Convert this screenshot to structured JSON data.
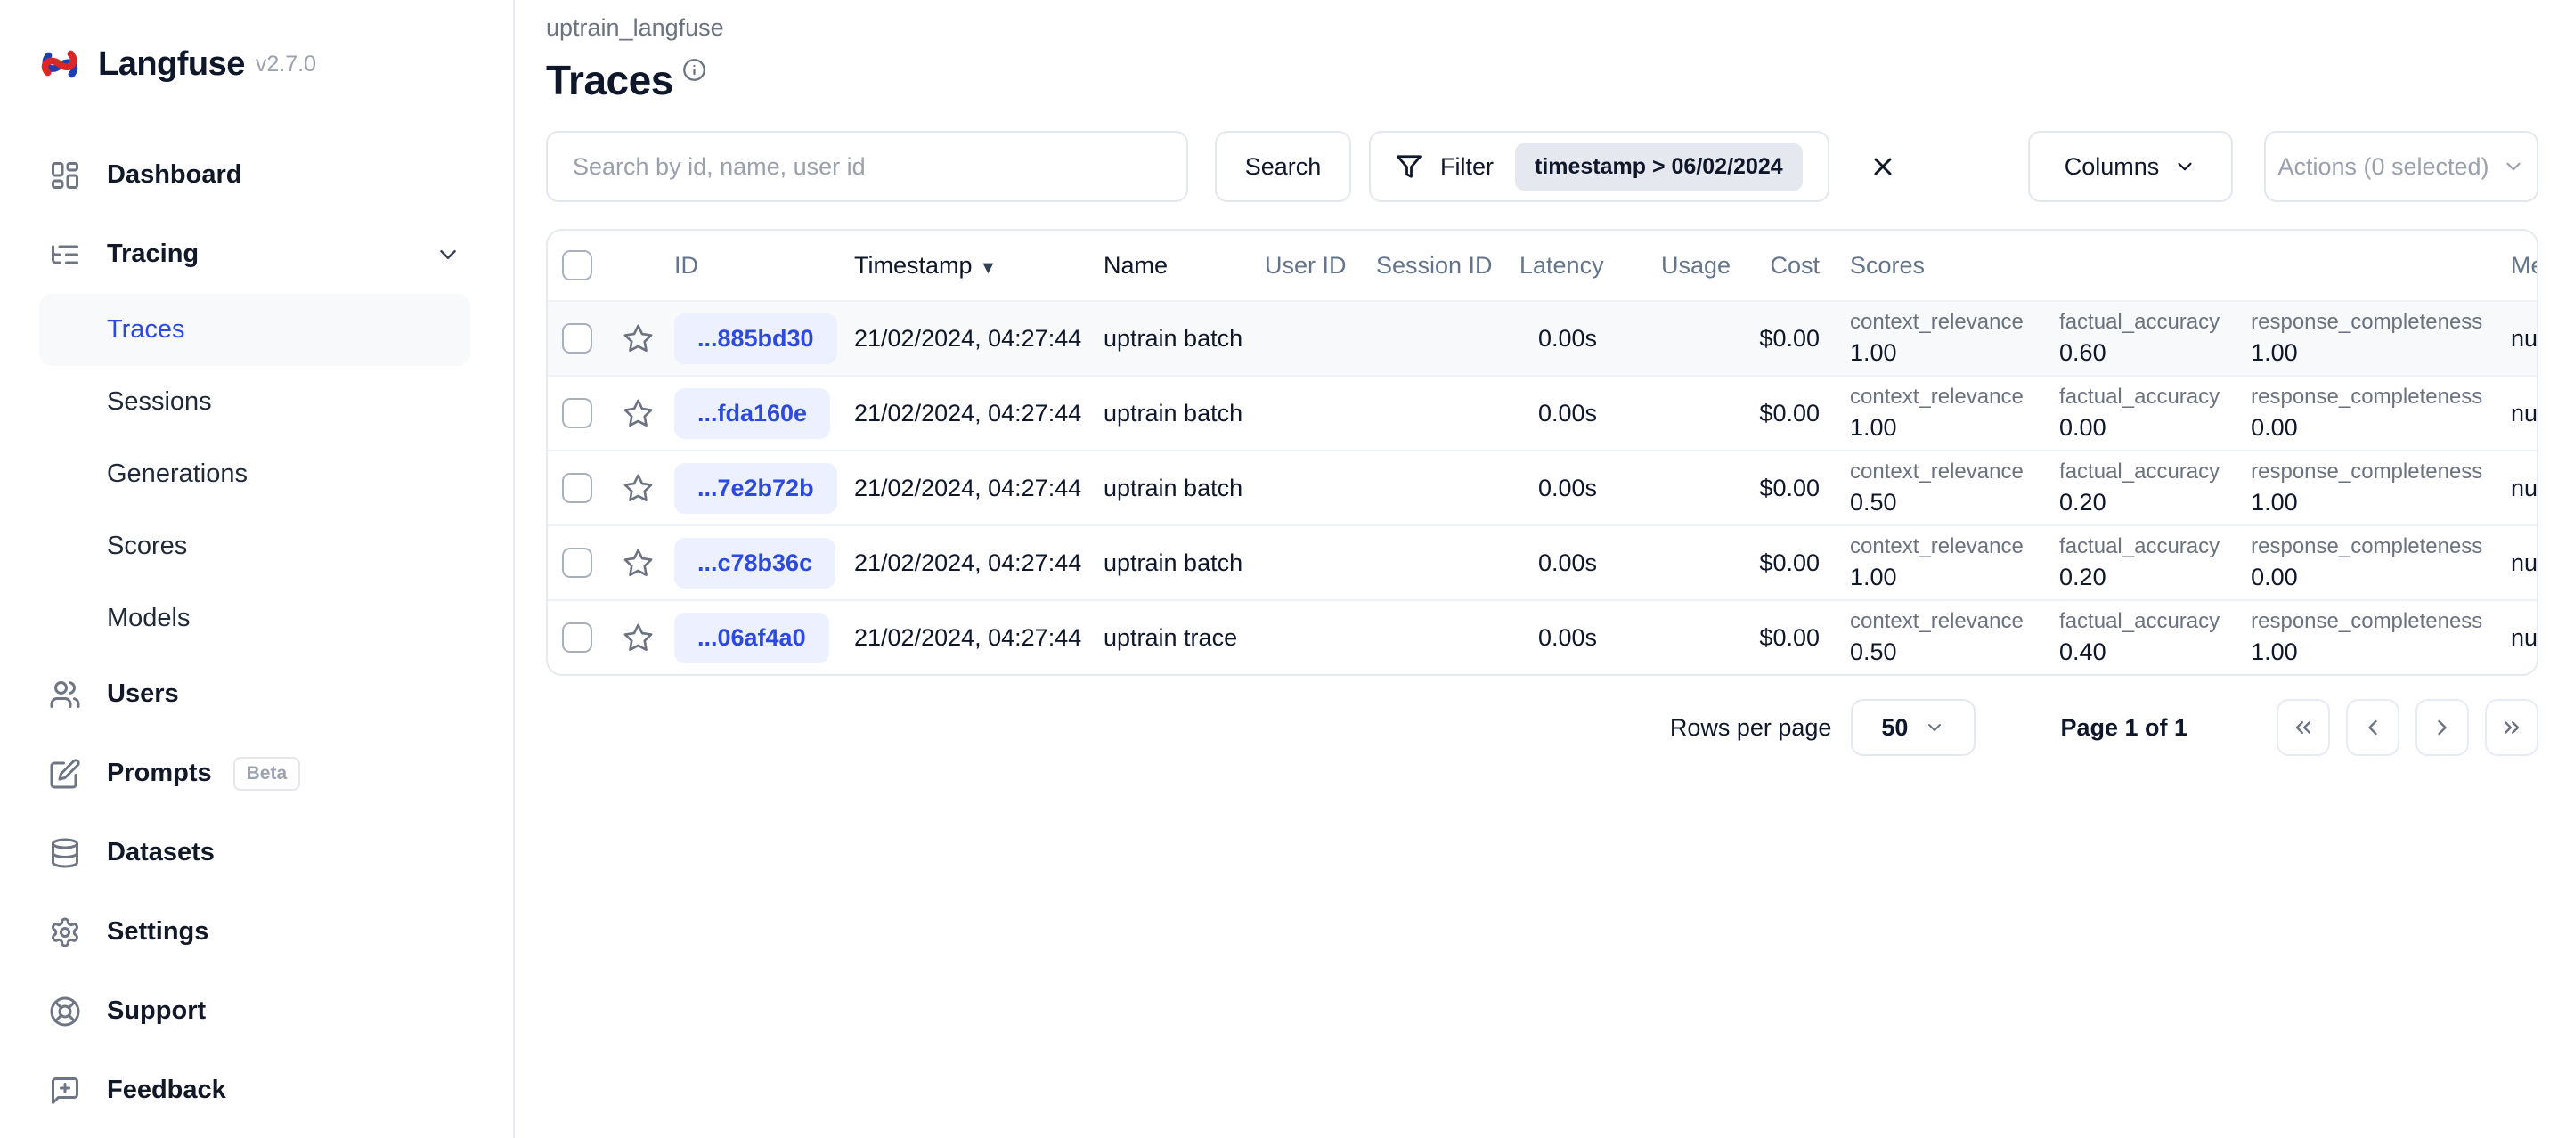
{
  "app": {
    "name": "Langfuse",
    "version": "v2.7.0"
  },
  "colors": {
    "accent_blue": "#2c4ae0",
    "brand_red": "#dc2626",
    "brand_blue": "#1e40af",
    "id_pill_bg": "#edf0fe",
    "filter_chip_bg": "#e5e8ef",
    "active_item_bg": "#f8f9fb"
  },
  "icons": {
    "dashboard": "layout-grid",
    "tracing": "list-tree",
    "users": "people",
    "prompts": "pen-square",
    "datasets": "database",
    "settings": "gear",
    "support": "life-buoy",
    "feedback": "message-square-plus",
    "filter": "funnel",
    "info": "circle-i",
    "close": "x",
    "star": "star-outline",
    "sort_desc": "▼",
    "chevron_down": "v",
    "page_first": "«",
    "page_prev": "‹",
    "page_next": "›",
    "page_last": "»"
  },
  "sidebar": {
    "dashboard": "Dashboard",
    "tracing": "Tracing",
    "traces": "Traces",
    "sessions": "Sessions",
    "generations": "Generations",
    "scores": "Scores",
    "models": "Models",
    "users": "Users",
    "prompts": "Prompts",
    "prompts_badge": "Beta",
    "datasets": "Datasets",
    "settings": "Settings",
    "support": "Support",
    "feedback": "Feedback"
  },
  "header": {
    "breadcrumb": "uptrain_langfuse",
    "title": "Traces"
  },
  "toolbar": {
    "search_placeholder": "Search by id, name, user id",
    "search_button": "Search",
    "filter_label": "Filter",
    "filter_chip": "timestamp > 06/02/2024",
    "columns_label": "Columns",
    "actions_label": "Actions (0 selected)"
  },
  "table": {
    "sort_indicator": "▼",
    "columns": {
      "id": "ID",
      "timestamp": "Timestamp",
      "name": "Name",
      "user_id": "User ID",
      "session_id": "Session ID",
      "latency": "Latency",
      "usage": "Usage",
      "cost": "Cost",
      "scores": "Scores",
      "metadata": "Metadata"
    },
    "rows": [
      {
        "id": "...885bd30",
        "timestamp": "21/02/2024, 04:27:44",
        "name": "uptrain batch",
        "latency": "0.00s",
        "cost": "$0.00",
        "metadata": "null",
        "scores": [
          {
            "label": "context_relevance",
            "value": "1.00"
          },
          {
            "label": "factual_accuracy",
            "value": "0.60"
          },
          {
            "label": "response_completeness",
            "value": "1.00"
          }
        ]
      },
      {
        "id": "...fda160e",
        "timestamp": "21/02/2024, 04:27:44",
        "name": "uptrain batch",
        "latency": "0.00s",
        "cost": "$0.00",
        "metadata": "null",
        "scores": [
          {
            "label": "context_relevance",
            "value": "1.00"
          },
          {
            "label": "factual_accuracy",
            "value": "0.00"
          },
          {
            "label": "response_completeness",
            "value": "0.00"
          }
        ]
      },
      {
        "id": "...7e2b72b",
        "timestamp": "21/02/2024, 04:27:44",
        "name": "uptrain batch",
        "latency": "0.00s",
        "cost": "$0.00",
        "metadata": "null",
        "scores": [
          {
            "label": "context_relevance",
            "value": "0.50"
          },
          {
            "label": "factual_accuracy",
            "value": "0.20"
          },
          {
            "label": "response_completeness",
            "value": "1.00"
          }
        ]
      },
      {
        "id": "...c78b36c",
        "timestamp": "21/02/2024, 04:27:44",
        "name": "uptrain batch",
        "latency": "0.00s",
        "cost": "$0.00",
        "metadata": "null",
        "scores": [
          {
            "label": "context_relevance",
            "value": "1.00"
          },
          {
            "label": "factual_accuracy",
            "value": "0.20"
          },
          {
            "label": "response_completeness",
            "value": "0.00"
          }
        ]
      },
      {
        "id": "...06af4a0",
        "timestamp": "21/02/2024, 04:27:44",
        "name": "uptrain trace",
        "latency": "0.00s",
        "cost": "$0.00",
        "metadata": "null",
        "scores": [
          {
            "label": "context_relevance",
            "value": "0.50"
          },
          {
            "label": "factual_accuracy",
            "value": "0.40"
          },
          {
            "label": "response_completeness",
            "value": "1.00"
          }
        ]
      }
    ]
  },
  "pagination": {
    "rows_per_page_label": "Rows per page",
    "rows_per_page_value": "50",
    "page_info": "Page 1 of 1"
  }
}
